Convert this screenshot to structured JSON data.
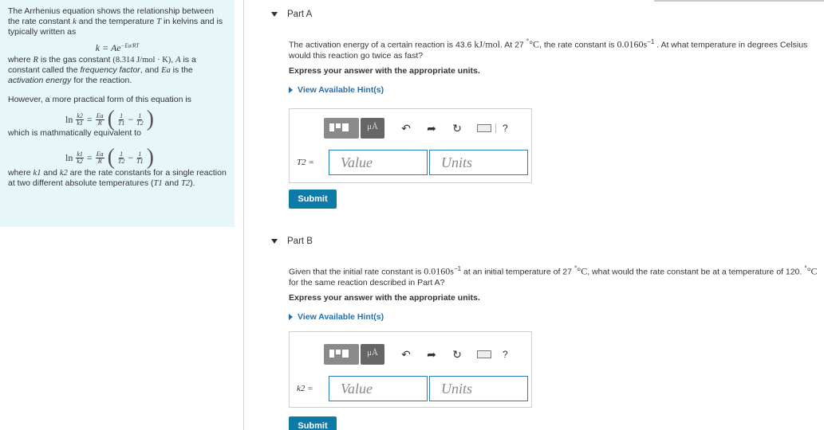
{
  "info": {
    "intro": "The Arrhenius equation shows the relationship between the rate constant",
    "intro_k": "k",
    "intro_and": "and the temperature",
    "intro_T": "T",
    "intro_end": "in kelvins and is typically written as",
    "eq1": "k = Ae",
    "eq1_exp": "−Ea/RT",
    "where_R": "where",
    "R": "R",
    "is_gas_constant": "is the gas constant",
    "gas_value": "(8.314 J/mol · K)",
    "A_label": "A",
    "is_a": "is a constant called the",
    "frequency_factor": "frequency factor",
    "and_Ea": "and",
    "Ea": "Ea",
    "is_the": "is the",
    "activation_energy": "activation energy",
    "for_reaction": "for the reaction.",
    "however": "However, a more practical form of this equation is",
    "ln": "ln",
    "k2": "k2",
    "k1": "k1",
    "Ea_frac": "Ea",
    "R_frac": "R",
    "one": "1",
    "T1": "T1",
    "T2": "T2",
    "equals": "=",
    "minus": "−",
    "equivalent": "which is mathmatically equivalent to",
    "where_k": "where",
    "k1_text": "k1",
    "and_text": "and",
    "k2_text": "k2",
    "rate_constants": "are the rate constants for a single reaction at two different absolute temperatures (",
    "T1_text": "T1",
    "and2": "and",
    "T2_text": "T2",
    "close": ")."
  },
  "partA": {
    "label": "Part A",
    "q_pre": "The activation energy of a certain reaction is 43.6",
    "q_unit1": "kJ/mol",
    "q_mid": ". At 27",
    "q_deg": "°C",
    "q_mid2": ", the rate constant is",
    "q_val": "0.0160s",
    "q_exp": "−1",
    "q_post": ". At what temperature in degrees Celsius would this reaction go twice as fast?",
    "express": "Express your answer with the appropriate units.",
    "hint": "View Available Hint(s)",
    "field_label": "T2 =",
    "value_placeholder": "Value",
    "units_placeholder": "Units",
    "submit": "Submit",
    "mu": "μÅ"
  },
  "partB": {
    "label": "Part B",
    "q_pre": "Given that the initial rate constant is",
    "q_val": "0.0160s",
    "q_exp": "−1",
    "q_mid": "at an initial temperature of 27",
    "q_deg": "°C",
    "q_post": ", what would the rate constant be at a temperature of 120.",
    "q_deg2": "°C",
    "q_post2": "for the same reaction described in Part A?",
    "express": "Express your answer with the appropriate units.",
    "hint": "View Available Hint(s)",
    "field_label": "k2 =",
    "value_placeholder": "Value",
    "units_placeholder": "Units",
    "submit": "Submit",
    "mu": "μÅ"
  },
  "toolbar": {
    "undo_icon": "undo-icon",
    "redo_icon": "redo-icon",
    "reset_icon": "reset-icon",
    "keyboard_icon": "keyboard-icon",
    "help": "?"
  }
}
